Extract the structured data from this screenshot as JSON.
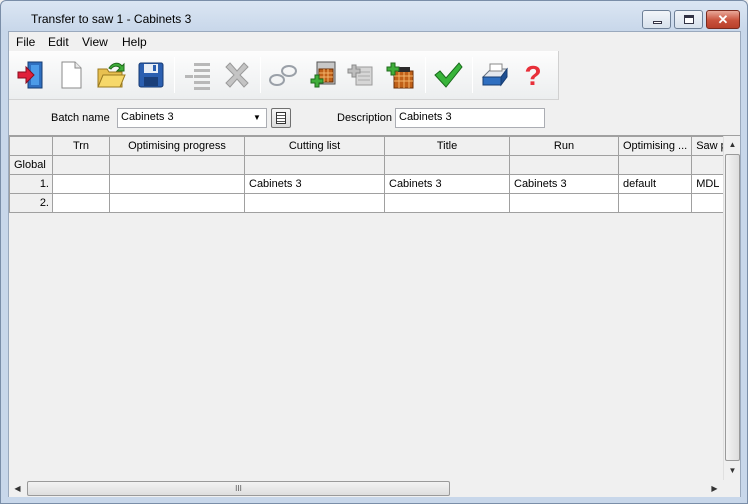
{
  "window": {
    "title": "Transfer to saw 1 - Cabinets 3"
  },
  "menu": [
    "File",
    "Edit",
    "View",
    "Help"
  ],
  "toolbar": {
    "buttons": [
      {
        "icon": "exit-icon"
      },
      {
        "icon": "new-document-icon"
      },
      {
        "icon": "open-folder-icon"
      },
      {
        "icon": "save-disk-icon"
      },
      {
        "icon": "remove-rows-icon"
      },
      {
        "icon": "delete-x-icon"
      },
      {
        "icon": "link-chain-icon"
      },
      {
        "icon": "add-batch-icon"
      },
      {
        "icon": "copy-batch-icon"
      },
      {
        "icon": "add-stack-icon"
      },
      {
        "icon": "check-icon"
      },
      {
        "icon": "printer-icon"
      },
      {
        "icon": "help-icon"
      }
    ]
  },
  "filter": {
    "batch_label": "Batch name",
    "batch_value": "Cabinets 3",
    "description_label": "Description",
    "description_value": "Cabinets 3"
  },
  "grid": {
    "headers": [
      "",
      "Trn",
      "Optimising progress",
      "Cutting list",
      "Title",
      "Run",
      "Optimising ...",
      "Saw pa"
    ],
    "rows": [
      [
        "Global",
        "",
        "",
        "",
        "",
        "",
        "",
        ""
      ],
      [
        "1.",
        "",
        "",
        "Cabinets 3",
        "Cabinets 3",
        "Cabinets 3",
        "default",
        "MDL"
      ],
      [
        "2.",
        "",
        "",
        "",
        "",
        "",
        "",
        ""
      ]
    ],
    "hscroll_grip": "III"
  }
}
